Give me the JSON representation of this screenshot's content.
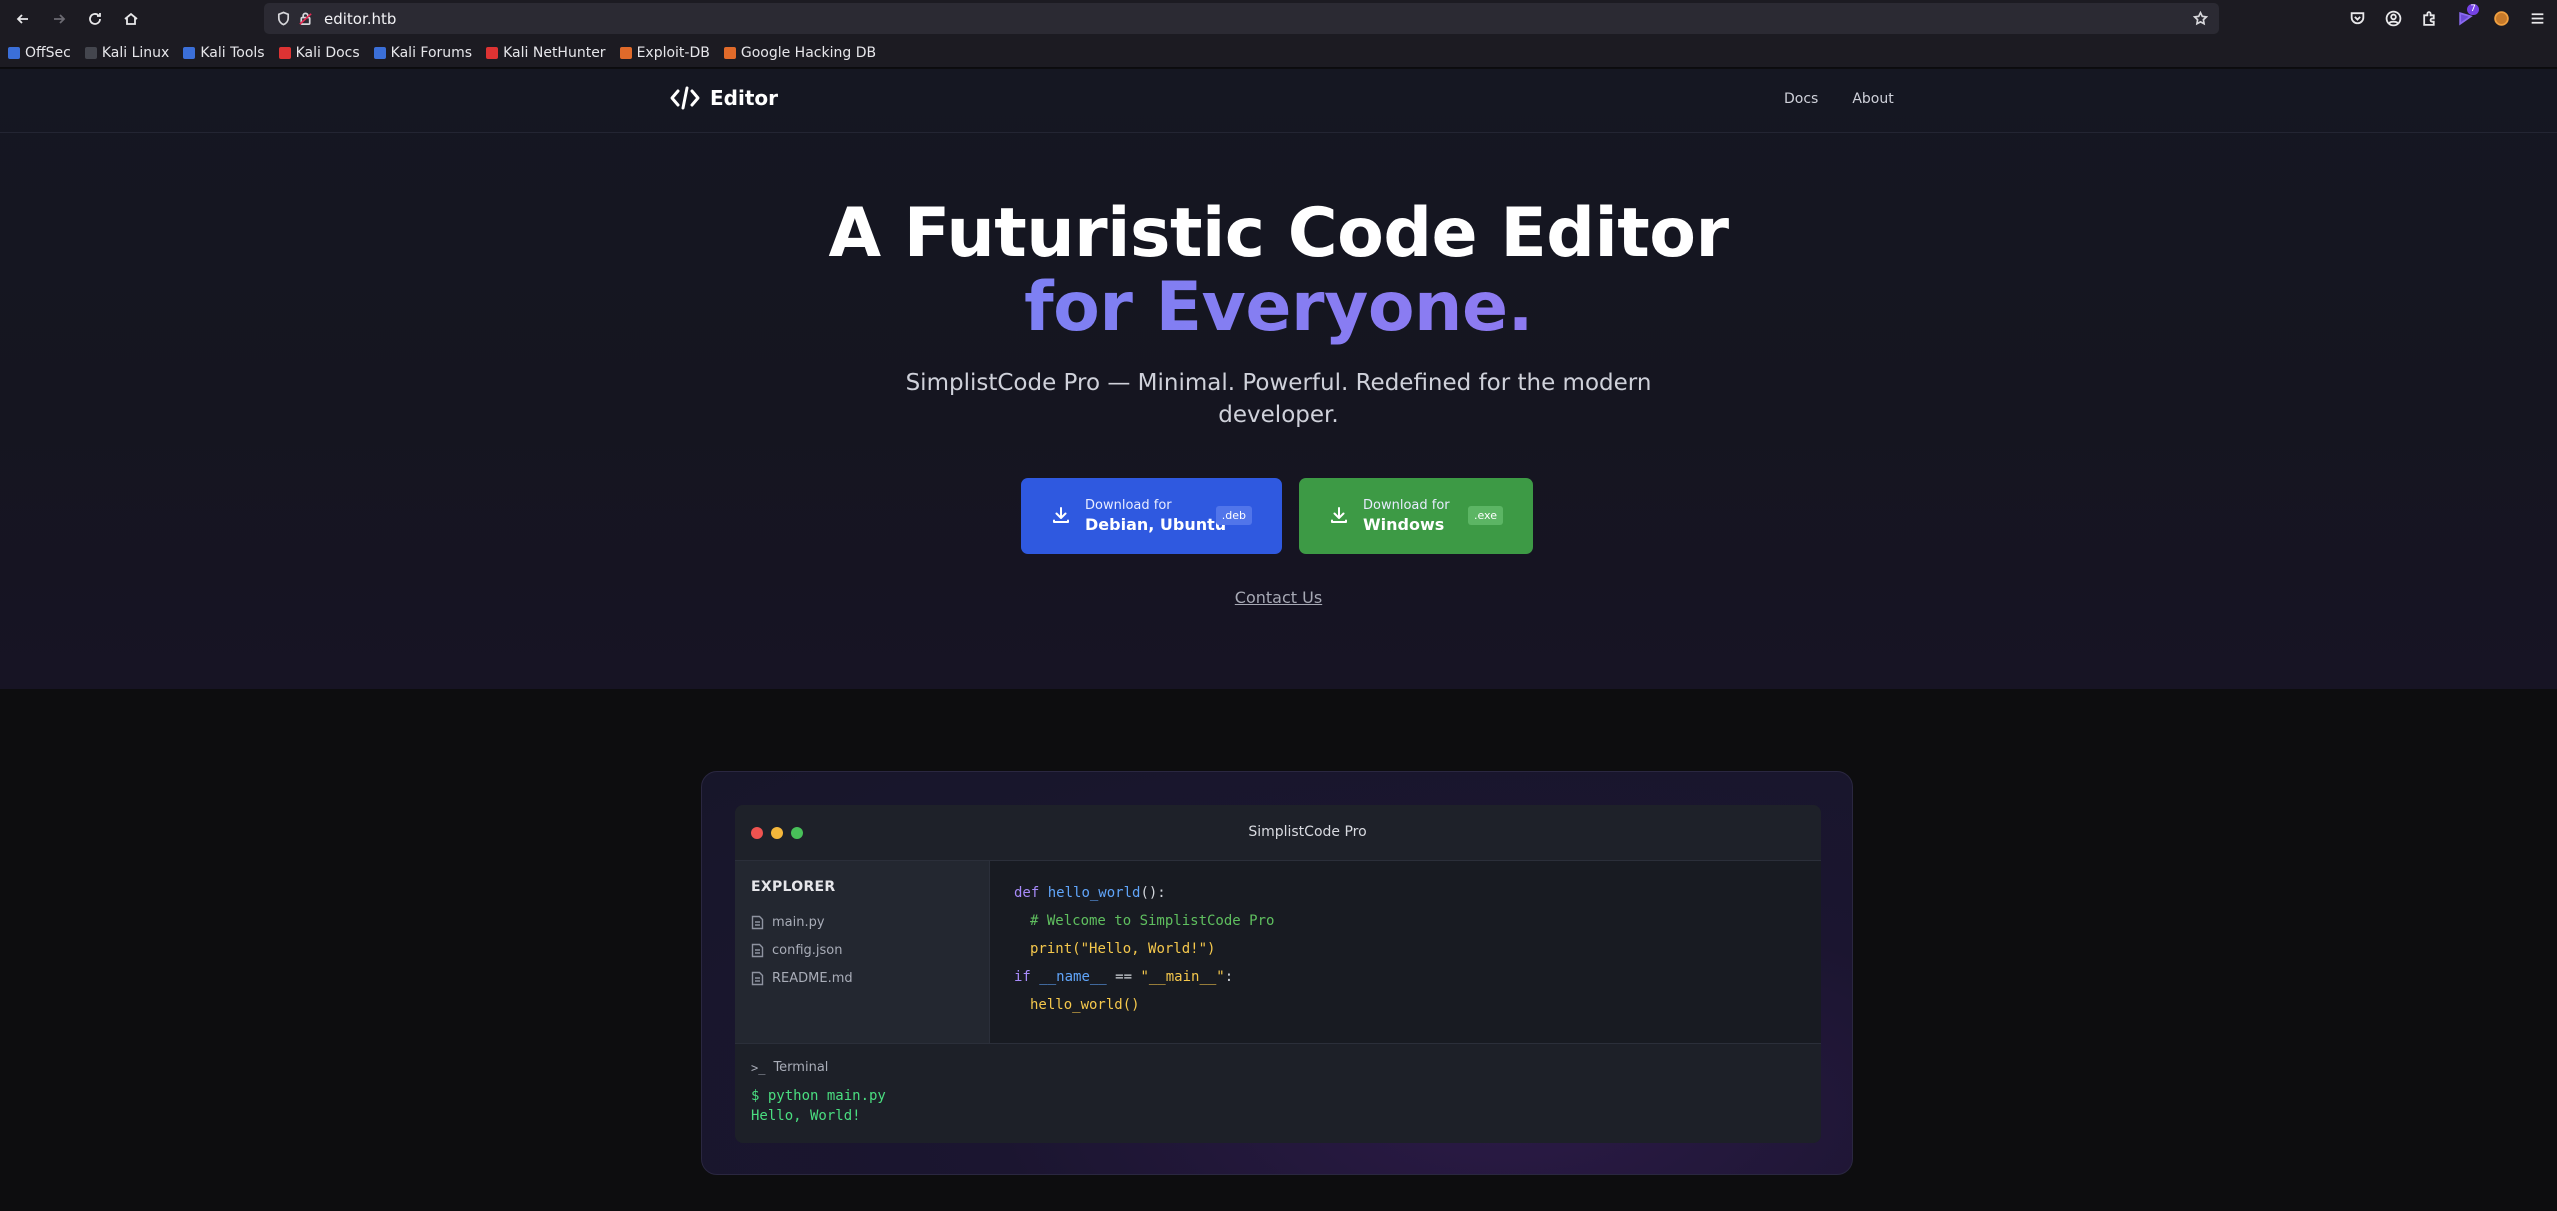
{
  "browser": {
    "url": "editor.htb",
    "extension_badge": "7",
    "bookmarks": [
      {
        "label": "OffSec",
        "color": "#3b6fd8"
      },
      {
        "label": "Kali Linux",
        "color": "#2a2a2a"
      },
      {
        "label": "Kali Tools",
        "color": "#3b6fd8"
      },
      {
        "label": "Kali Docs",
        "color": "#d33"
      },
      {
        "label": "Kali Forums",
        "color": "#3b6fd8"
      },
      {
        "label": "Kali NetHunter",
        "color": "#d33"
      },
      {
        "label": "Exploit-DB",
        "color": "#e06a2a"
      },
      {
        "label": "Google Hacking DB",
        "color": "#e06a2a"
      }
    ]
  },
  "site": {
    "logo_text": "Editor",
    "nav": [
      "Docs",
      "About"
    ],
    "hero": {
      "title_line1": "A Futuristic Code Editor",
      "title_line2": "for Everyone.",
      "subtitle": "SimplistCode Pro — Minimal. Powerful. Redefined for the modern developer."
    },
    "downloads": [
      {
        "small": "Download for",
        "big": "Debian, Ubuntu",
        "tag": ".deb",
        "color": "#2f59e0"
      },
      {
        "small": "Download for",
        "big": "Windows",
        "tag": ".exe",
        "color": "#3d9a45"
      }
    ],
    "contact_label": "Contact Us"
  },
  "editor_preview": {
    "window_title": "SimplistCode Pro",
    "explorer": {
      "heading": "EXPLORER",
      "files": [
        "main.py",
        "config.json",
        "README.md"
      ]
    },
    "code": {
      "l1_kw": "def",
      "l1_fn": "hello_world",
      "l1_rest": "():",
      "l2_comment": "# Welcome to SimplistCode Pro",
      "l3_fn": "print",
      "l3_args": "(\"Hello, World!\")",
      "l4_kw": "if",
      "l4_var": "__name__",
      "l4_op": " == ",
      "l4_str": "\"__main__\"",
      "l4_end": ":",
      "l5_fn": "hello_world",
      "l5_end": "()"
    },
    "terminal": {
      "label": "Terminal",
      "command": "$ python main.py",
      "output": "Hello, World!"
    }
  }
}
